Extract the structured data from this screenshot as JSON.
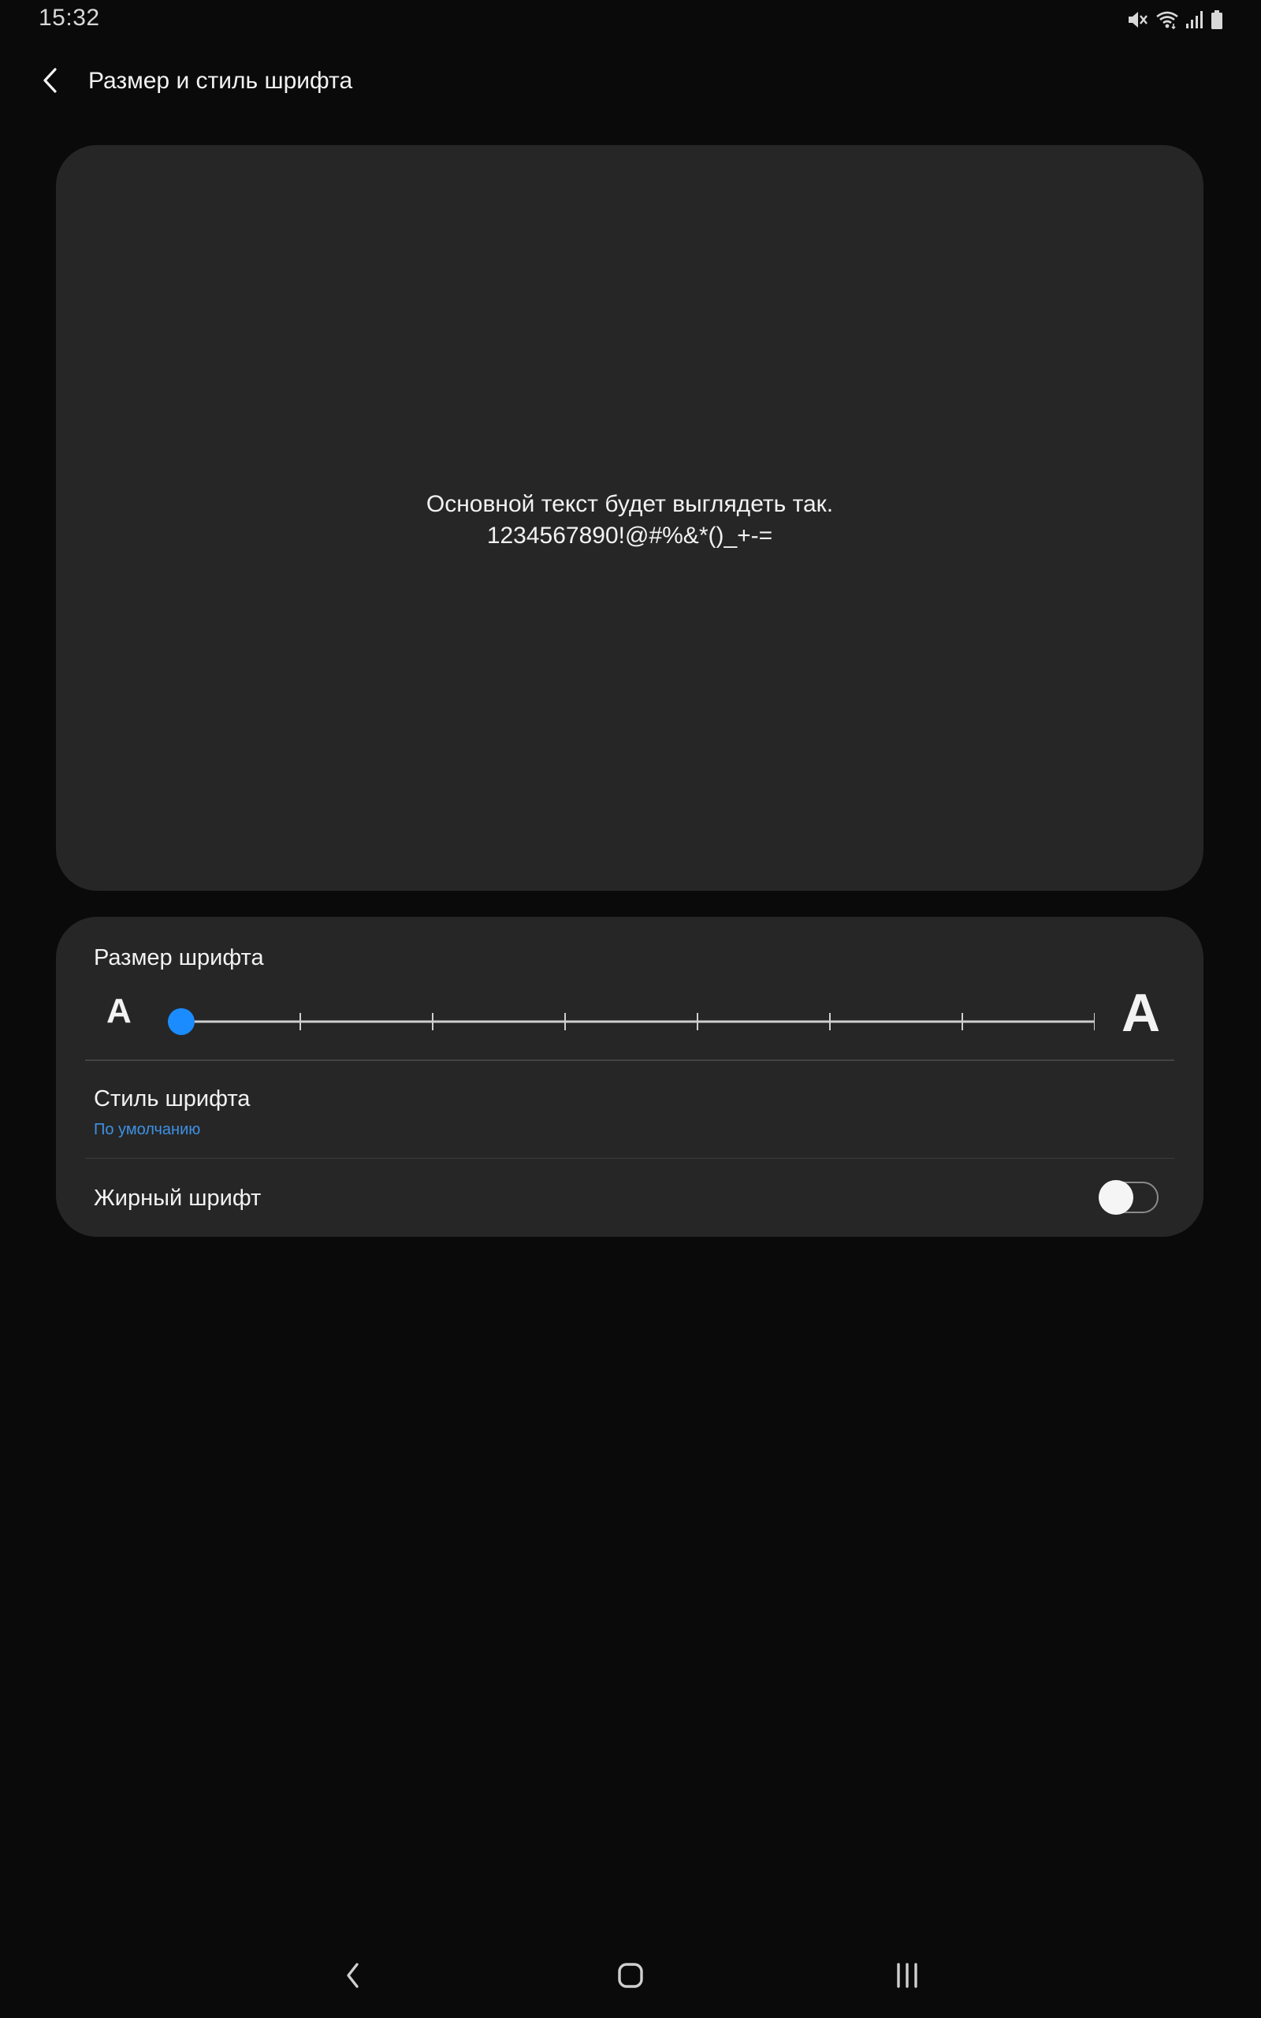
{
  "status_bar": {
    "time": "15:32",
    "icons": [
      "mute-icon",
      "wifi-icon",
      "signal-icon",
      "battery-icon"
    ]
  },
  "header": {
    "back_icon": "chevron-left-icon",
    "title": "Размер и стиль шрифта"
  },
  "preview": {
    "line1": "Основной текст будет выглядеть так.",
    "line2": "1234567890!@#%&*()_+-="
  },
  "font_size": {
    "label": "Размер шрифта",
    "small_glyph": "A",
    "large_glyph": "A",
    "steps": 8,
    "selected_step": 0
  },
  "font_style": {
    "label": "Стиль шрифта",
    "value": "По умолчанию"
  },
  "bold_font": {
    "label": "Жирный шрифт",
    "enabled": false
  },
  "nav_bar": {
    "icons": [
      "back-icon",
      "home-icon",
      "recents-icon"
    ]
  },
  "colors": {
    "background": "#0a0a0a",
    "card": "#262626",
    "accent": "#1a8cff",
    "link": "#3e91e5"
  }
}
